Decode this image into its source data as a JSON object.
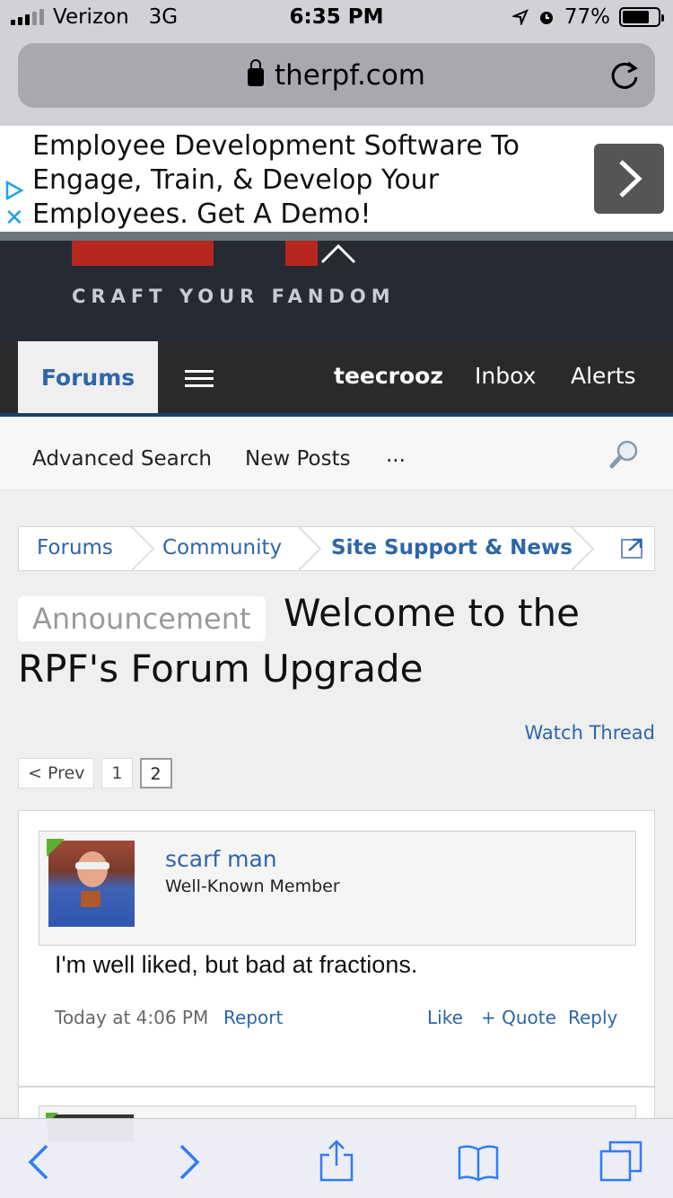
{
  "status_bar": {
    "carrier": "Verizon",
    "network": "3G",
    "time": "6:35 PM",
    "battery": "77%",
    "battery_level": 0.77
  },
  "browser": {
    "url": "therpf.com"
  },
  "ad": {
    "text": "Employee Development Software To Engage, Train, & Develop Your Employees. Get A Demo!"
  },
  "header": {
    "tagline": "CRAFT YOUR FANDOM"
  },
  "nav": {
    "forums": "Forums",
    "username": "teecrooz",
    "inbox": "Inbox",
    "alerts": "Alerts"
  },
  "subnav": {
    "advanced_search": "Advanced Search",
    "new_posts": "New Posts",
    "more": "..."
  },
  "breadcrumb": [
    "Forums",
    "Community",
    "Site Support & News"
  ],
  "thread": {
    "prefix": "Announcement",
    "title_line1": "Welcome to the",
    "title_line2": "RPF's Forum Upgrade",
    "watch": "Watch Thread"
  },
  "pager": {
    "prev": "< Prev",
    "pages": [
      "1",
      "2"
    ],
    "current": "2"
  },
  "post": {
    "username": "scarf man",
    "user_title": "Well-Known Member",
    "message": "I'm well liked, but bad at fractions.",
    "date": "Today at 4:06 PM",
    "report": "Report",
    "like": "Like",
    "quote": "+ Quote",
    "reply": "Reply"
  },
  "colors": {
    "link": "#2e66a8",
    "header_bg": "#252a33",
    "logo_red": "#b7261f",
    "online": "#5bb12f"
  }
}
